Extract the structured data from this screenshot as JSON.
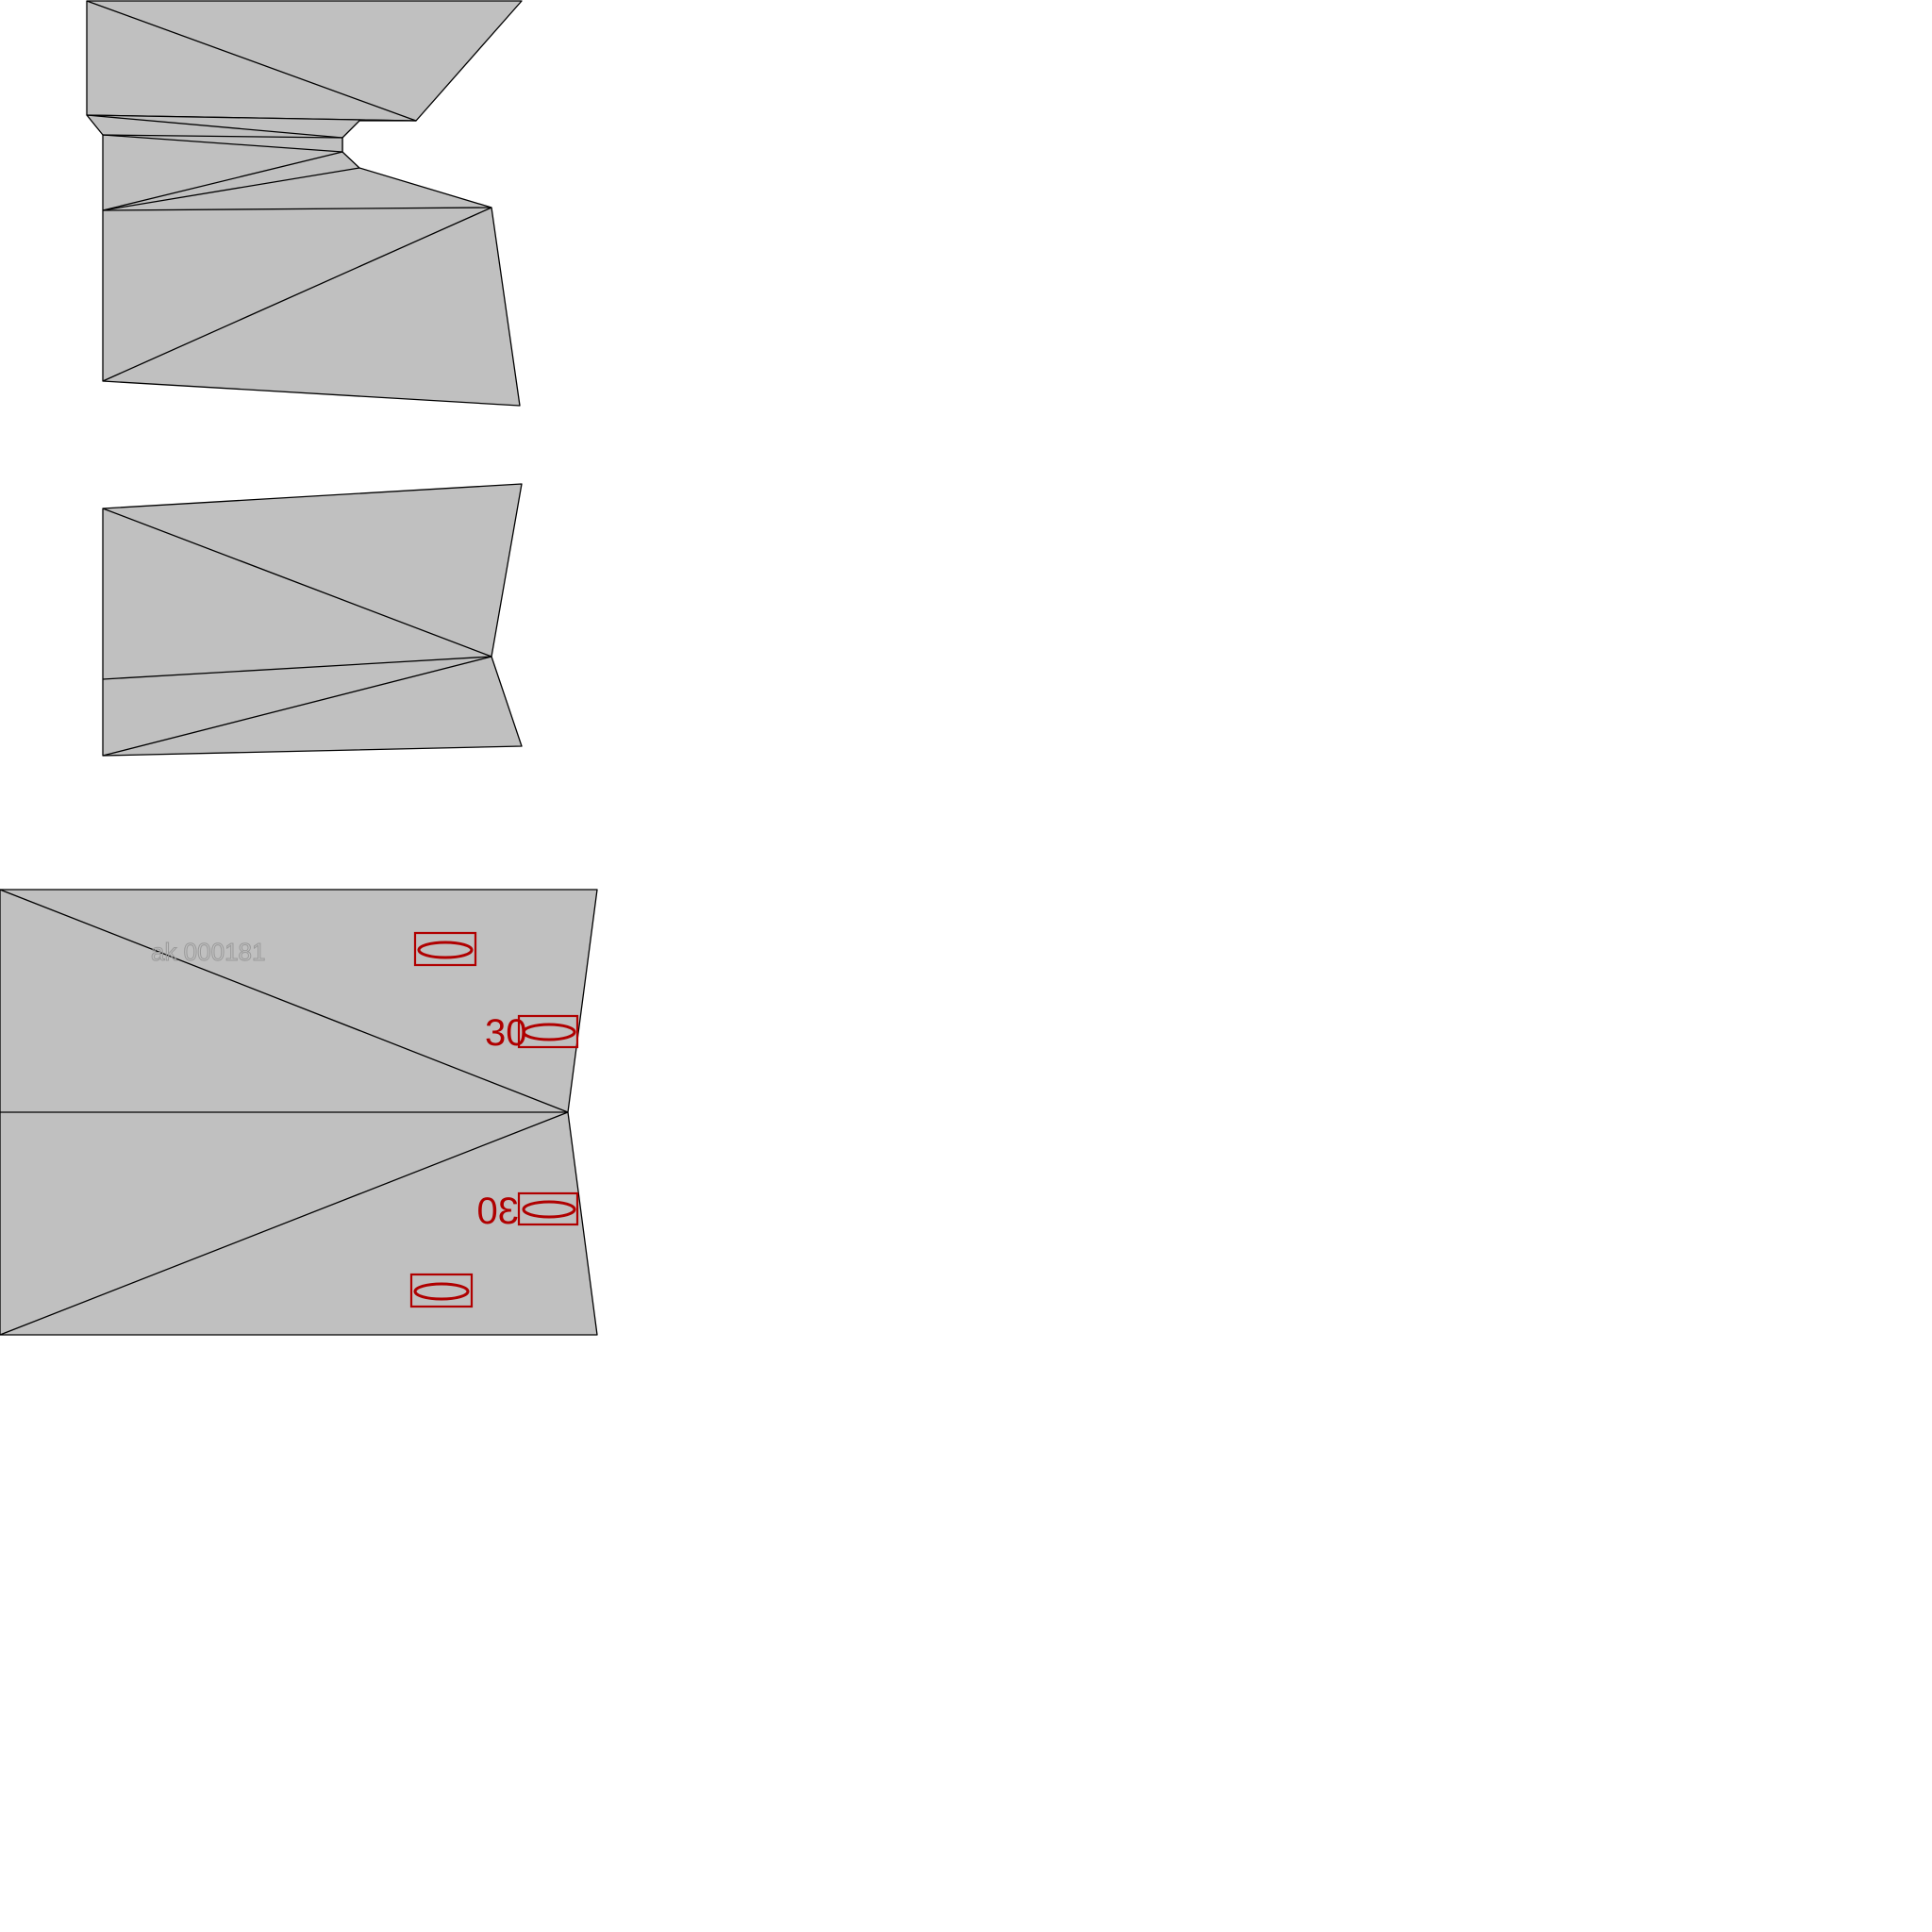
{
  "diagram": {
    "colors": {
      "background": "#ffffff",
      "panel_fill": "#c0c0c0",
      "panel_edge": "#000000",
      "marking": "#b00000",
      "faint_text": "#9a9a9a"
    },
    "faint_code": "ak 000181",
    "markings": [
      {
        "id": "upper-box",
        "number": ""
      },
      {
        "id": "upper-box-30",
        "number": "30"
      },
      {
        "id": "lower-box-30",
        "number": "30"
      },
      {
        "id": "lower-box",
        "number": ""
      }
    ]
  }
}
